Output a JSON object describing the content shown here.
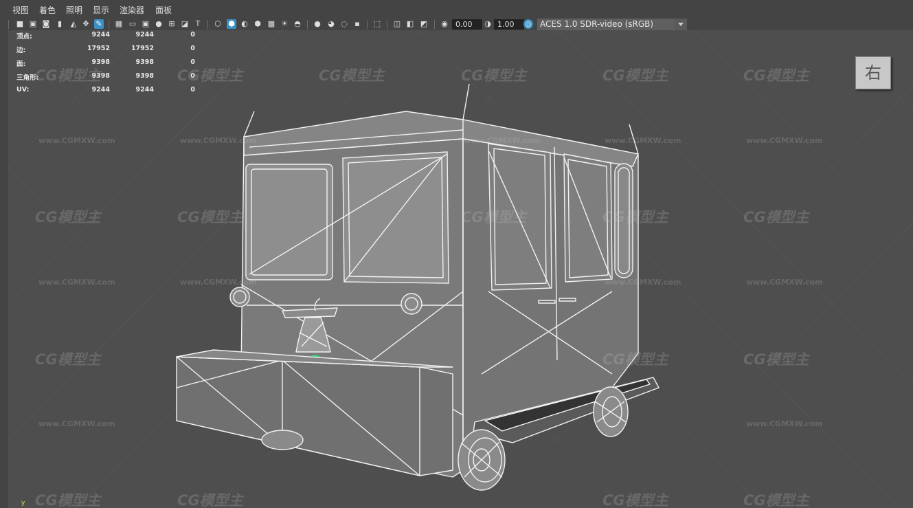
{
  "menu": [
    "视图",
    "着色",
    "照明",
    "显示",
    "渲染器",
    "面板"
  ],
  "toolbar": {
    "exposure": "0.00",
    "gamma": "1.00",
    "color_space": "ACES 1.0 SDR-video (sRGB)",
    "icons": [
      "camera-select-icon",
      "camera-lock-icon",
      "camera-attributes-icon",
      "bookmark-icon",
      "image-plane-icon",
      "grid-icon",
      "film-gate-icon",
      "resolution-gate-icon",
      "gate-mask-icon",
      "field-chart-icon",
      "safe-action-icon",
      "safe-title-icon",
      "wireframe-icon",
      "smooth-shade-icon",
      "default-material-icon",
      "textured-icon",
      "use-lights-icon",
      "shadows-icon",
      "screen-space-ao-icon",
      "motion-blur-icon",
      "anti-aliasing-icon",
      "depth-of-field-icon",
      "isolate-select-icon",
      "xray-icon",
      "xray-joints-icon",
      "xray-components-icon",
      "exposure-icon",
      "gamma-icon",
      "color-management-icon"
    ]
  },
  "hud": {
    "rows": [
      {
        "label": "顶点:",
        "a": "9244",
        "b": "9244",
        "c": "0"
      },
      {
        "label": "边:",
        "a": "17952",
        "b": "17952",
        "c": "0"
      },
      {
        "label": "面:",
        "a": "9398",
        "b": "9398",
        "c": "0"
      },
      {
        "label": "三角形:",
        "a": "9398",
        "b": "9398",
        "c": "0"
      },
      {
        "label": "UV:",
        "a": "9244",
        "b": "9244",
        "c": "0"
      }
    ]
  },
  "viewcube_label": "右",
  "axis_label": "y",
  "watermark": {
    "logo": "CG模型主",
    "url": "www.CGMXW.com"
  }
}
